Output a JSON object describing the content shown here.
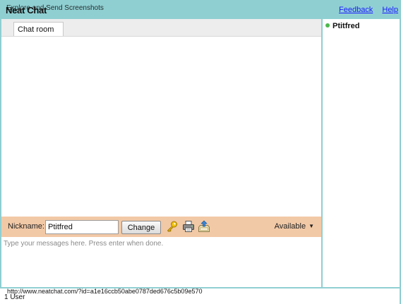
{
  "header": {
    "brand": "Neat Chat",
    "subtitle": "Explore and Send Screenshots",
    "links": {
      "feedback": "Feedback",
      "help": "Help"
    }
  },
  "colors": {
    "accent": "#8fcfd2",
    "toolbar": "#f2c9a6",
    "online": "#4cb84c",
    "link": "#1a1aff"
  },
  "tabs": [
    {
      "label": "Chat room"
    }
  ],
  "toolbar": {
    "nickname_label": "Nickname:",
    "nickname_value": "Ptitfred",
    "change_label": "Change",
    "icons": [
      "key-icon",
      "print-icon",
      "export-icon"
    ],
    "status": "Available"
  },
  "message_input": {
    "placeholder": "Type your messages here. Press enter when done."
  },
  "users": [
    {
      "name": "Ptitfred",
      "status": "online"
    }
  ],
  "footer": {
    "url": "http://www.neatchat.com/?id=a1e16ccb50abe0787ded676c5b09e570",
    "user_count": "1 User"
  }
}
